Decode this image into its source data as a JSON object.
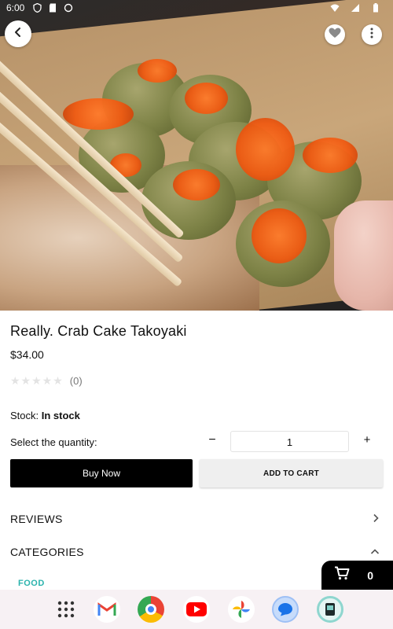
{
  "status_bar": {
    "time": "6:00",
    "left_icons": [
      "shield-icon",
      "sd-card-icon",
      "sync-icon"
    ],
    "right_icons": [
      "wifi-icon",
      "signal-icon",
      "battery-icon"
    ]
  },
  "hero": {
    "image_subject": "takoyaki-photo",
    "back_icon": "chevron-left-icon",
    "favorite_icon": "heart-icon",
    "more_icon": "more-vertical-icon"
  },
  "product": {
    "title": "Really. Crab Cake Takoyaki",
    "price": "$34.00",
    "rating_stars": 0,
    "rating_count": "(0)",
    "stock_label": "Stock:",
    "stock_value": "In stock"
  },
  "quantity": {
    "label": "Select the quantity:",
    "minus": "−",
    "value": "1",
    "plus": "+"
  },
  "actions": {
    "buy_now": "Buy Now",
    "add_to_cart": "ADD TO CART"
  },
  "sections": {
    "reviews": "REVIEWS",
    "categories": "CATEGORIES"
  },
  "categories": [
    "FOOD"
  ],
  "cart": {
    "count": "0",
    "icon": "cart-icon"
  },
  "dock": {
    "apps": [
      "app-drawer-icon",
      "gmail-icon",
      "chrome-icon",
      "youtube-icon",
      "photos-icon",
      "messages-icon",
      "reader-app-icon"
    ]
  },
  "colors": {
    "accent": "#2bb3ad",
    "primary_button": "#000000",
    "secondary_button": "#efefef",
    "dock_bg": "#f7f1f4"
  }
}
